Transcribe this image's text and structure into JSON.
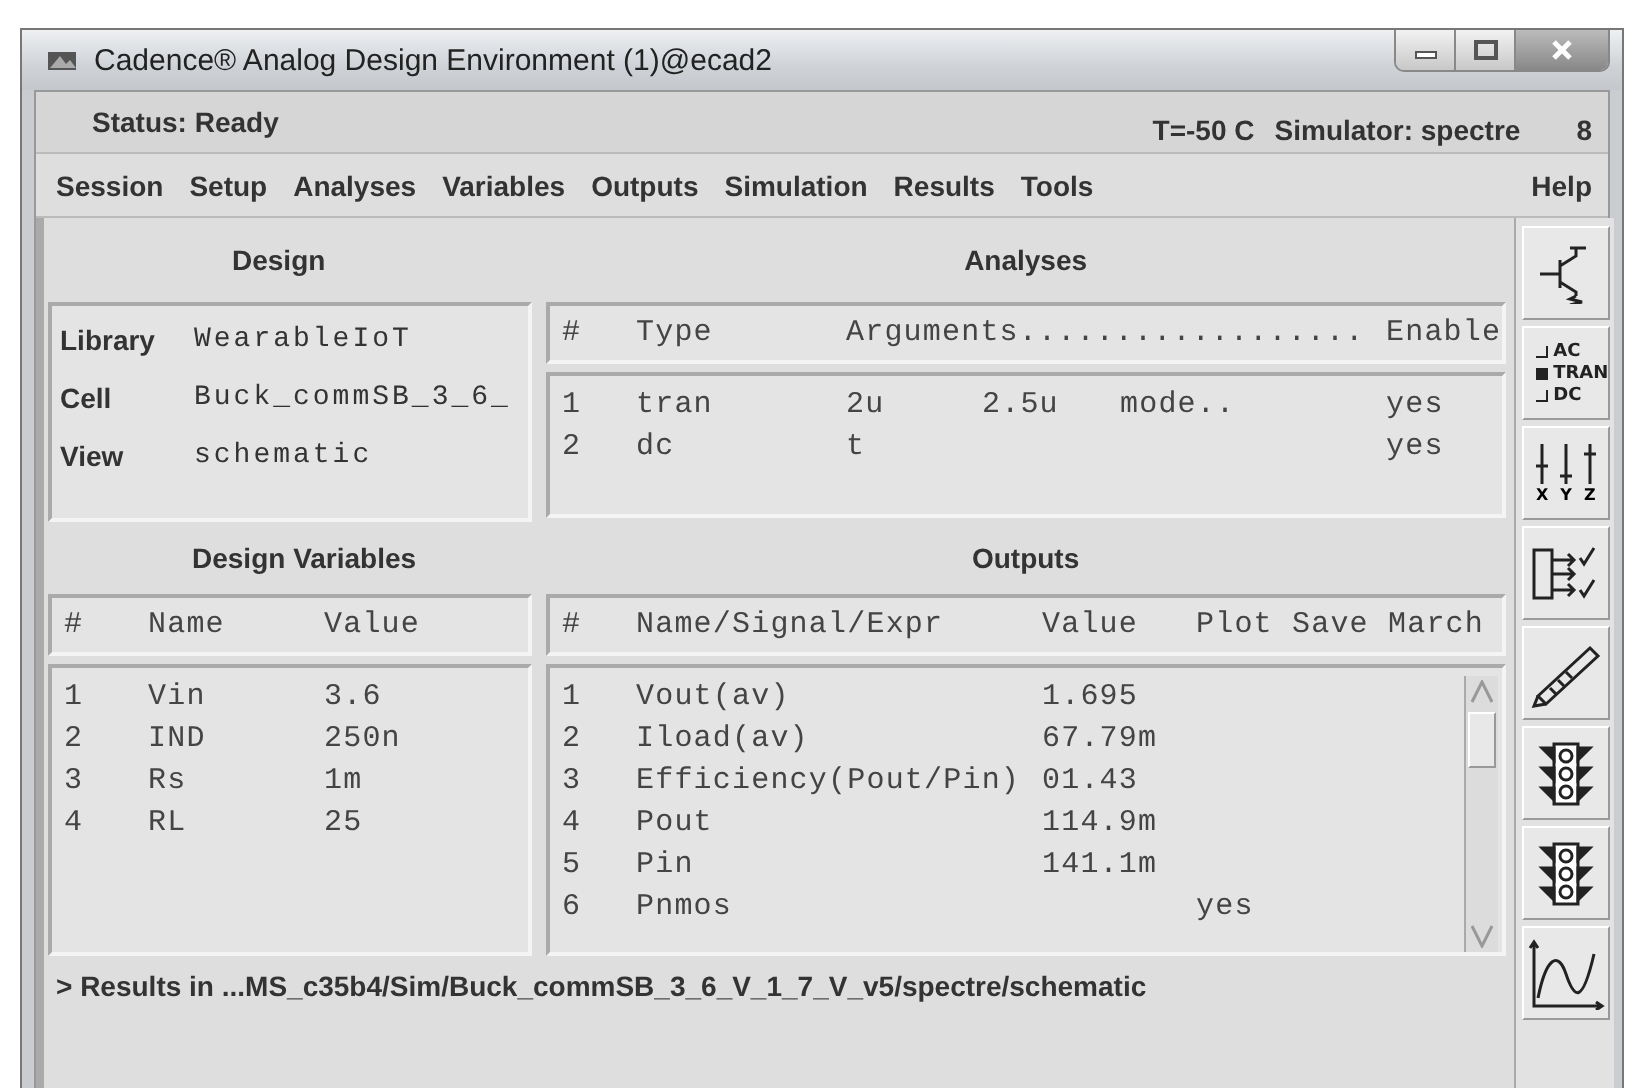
{
  "window": {
    "title": "Cadence® Analog Design Environment (1)@ecad2"
  },
  "status_bar": {
    "status": "Status: Ready",
    "temperature": "T=-50 C",
    "simulator": "Simulator: spectre",
    "number": "8"
  },
  "menu": [
    {
      "label": "Session"
    },
    {
      "label": "Setup"
    },
    {
      "label": "Analyses"
    },
    {
      "label": "Variables"
    },
    {
      "label": "Outputs"
    },
    {
      "label": "Simulation"
    },
    {
      "label": "Results"
    },
    {
      "label": "Tools"
    }
  ],
  "help_menu": {
    "label": "Help"
  },
  "design": {
    "heading": "Design",
    "fields": [
      {
        "label": "Library",
        "value": "WearableIoT"
      },
      {
        "label": "Cell",
        "value": "Buck_commSB_3_6_"
      },
      {
        "label": "View",
        "value": "schematic"
      }
    ]
  },
  "analyses": {
    "heading": "Analyses",
    "columns": [
      "#",
      "Type",
      "Arguments..................",
      "Enable"
    ],
    "rows": [
      {
        "number": "1",
        "type": "tran",
        "arguments": [
          "2u",
          "2.5u",
          "mode.."
        ],
        "enable": "yes"
      },
      {
        "number": "2",
        "type": "dc",
        "arguments": [
          "t"
        ],
        "enable": "yes"
      }
    ]
  },
  "design_variables": {
    "heading": "Design Variables",
    "columns": [
      "#",
      "Name",
      "Value"
    ],
    "rows": [
      {
        "number": "1",
        "name": "Vin",
        "value": "3.6"
      },
      {
        "number": "2",
        "name": "IND",
        "value": "250n"
      },
      {
        "number": "3",
        "name": "Rs",
        "value": "1m"
      },
      {
        "number": "4",
        "name": "RL",
        "value": "25"
      }
    ]
  },
  "outputs": {
    "heading": "Outputs",
    "columns": [
      "#",
      "Name/Signal/Expr",
      "Value",
      "Plot",
      "Save",
      "March"
    ],
    "rows": [
      {
        "number": "1",
        "name": "Vout(av)",
        "value": "1.695"
      },
      {
        "number": "2",
        "name": "Iload(av)",
        "value": "67.79m"
      },
      {
        "number": "3",
        "name": "Efficiency(Pout/Pin)",
        "value": "01.43"
      },
      {
        "number": "4",
        "name": "Pout",
        "value": "114.9m"
      },
      {
        "number": "5",
        "name": "Pin",
        "value": "141.1m"
      },
      {
        "number": "6",
        "name": "Pnmos",
        "plot": "yes"
      }
    ]
  },
  "results_line": "> Results in ...MS_c35b4/Sim/Buck_commSB_3_6_V_1_7_V_v5/spectre/schematic",
  "toolbar": [
    {
      "kind": "transistor"
    },
    {
      "kind": "analysis_choice",
      "options": [
        {
          "label": "AC",
          "selected": false
        },
        {
          "label": "TRAN",
          "selected": true
        },
        {
          "label": "DC",
          "selected": false
        }
      ]
    },
    {
      "kind": "sliders",
      "labels": [
        "X",
        "Y",
        "Z"
      ]
    },
    {
      "kind": "outputs"
    },
    {
      "kind": "pencil"
    },
    {
      "kind": "traffic_light"
    },
    {
      "kind": "traffic_light"
    },
    {
      "kind": "graph"
    }
  ]
}
